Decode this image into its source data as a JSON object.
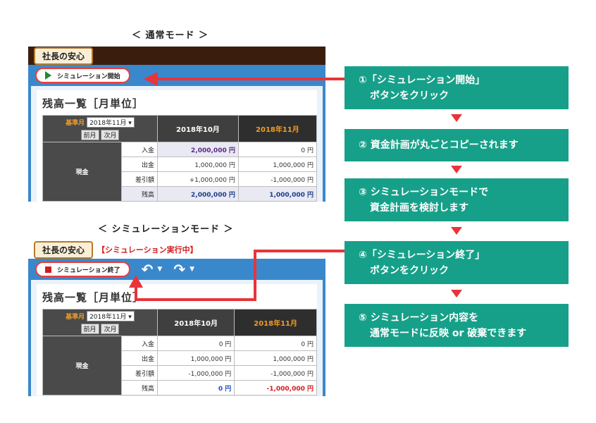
{
  "normal_heading": "＜ 通常モード ＞",
  "sim_heading": "＜ シミュレーションモード ＞",
  "brand": "社長の安心",
  "sim_badge": "【シミュレーション実行中】",
  "start_button": "シミュレーション開始",
  "end_button": "シミュレーション終了",
  "undo_icon": "undo-icon",
  "redo_icon": "redo-icon",
  "section_title": "残高一覧［月単位］",
  "kijun_label": "基準月",
  "kijun_value": "2018年11月",
  "prev_label": "前月",
  "next_label": "次月",
  "months": [
    "2018年10月",
    "2018年11月"
  ],
  "category": "現金",
  "row_labels": [
    "入金",
    "出金",
    "差引額",
    "残高"
  ],
  "normal_values": [
    [
      "2,000,000 円",
      "0 円"
    ],
    [
      "1,000,000 円",
      "1,000,000 円"
    ],
    [
      "+1,000,000 円",
      "-1,000,000 円"
    ],
    [
      "2,000,000 円",
      "1,000,000 円"
    ]
  ],
  "sim_values": [
    [
      "0 円",
      "0 円"
    ],
    [
      "1,000,000 円",
      "1,000,000 円"
    ],
    [
      "-1,000,000 円",
      "-1,000,000 円"
    ],
    [
      "0 円",
      "-1,000,000 円"
    ]
  ],
  "steps": [
    {
      "l1": "①「シミュレーション開始」",
      "l2": "ボタンをクリック"
    },
    {
      "l1": "② 資金計画が丸ごとコピーされます",
      "l2": ""
    },
    {
      "l1": "③ シミュレーションモードで",
      "l2": "資金計画を検討します"
    },
    {
      "l1": "④「シミュレーション終了」",
      "l2": "ボタンをクリック"
    },
    {
      "l1": "⑤ シミュレーション内容を",
      "l2": "通常モードに反映 or 破棄できます"
    }
  ],
  "colors": {
    "accent": "#17a089",
    "arrow": "#e8343a",
    "toolbar": "#3a88cc",
    "header_brown": "#3b1d0e"
  }
}
